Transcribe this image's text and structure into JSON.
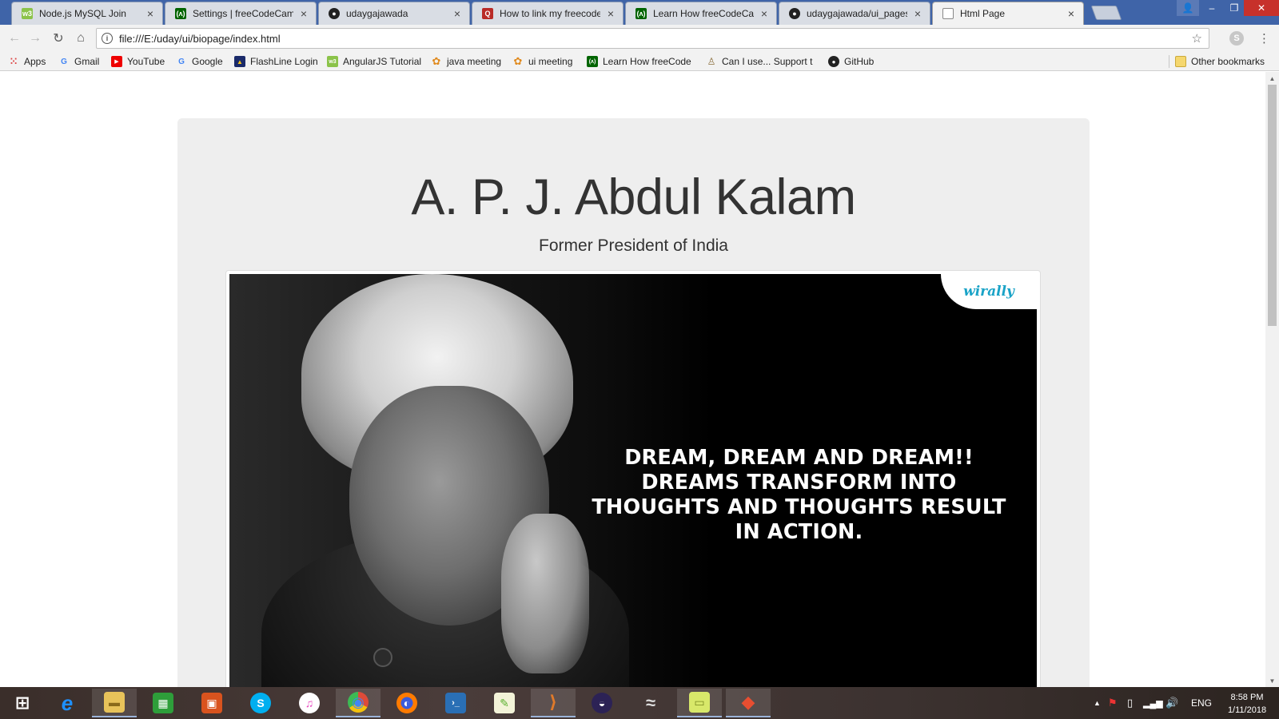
{
  "browser": {
    "tabs": [
      {
        "title": "Node.js MySQL Join",
        "icon": "w3schools-icon",
        "color": "#8bc34a",
        "active": false
      },
      {
        "title": "Settings | freeCodeCamp",
        "icon": "freecodecamp-icon",
        "color": "#006400",
        "active": false
      },
      {
        "title": "udaygajawada",
        "icon": "github-icon",
        "color": "#222222",
        "active": false
      },
      {
        "title": "How to link my freecode",
        "icon": "quora-icon",
        "color": "#b92b27",
        "active": false
      },
      {
        "title": "Learn How freeCodeCam",
        "icon": "freecodecamp-icon",
        "color": "#006400",
        "active": false
      },
      {
        "title": "udaygajawada/ui_pages",
        "icon": "github-icon",
        "color": "#222222",
        "active": false
      },
      {
        "title": "Html Page",
        "icon": "page-icon",
        "color": "#888888",
        "active": true
      }
    ],
    "close_glyph": "×",
    "window_controls": {
      "user": "👤",
      "minimize": "–",
      "maximize": "❐",
      "close": "✕"
    },
    "url": "file:///E:/uday/ui/biopage/index.html",
    "star_glyph": "☆",
    "skype_glyph": "S",
    "menu_glyph": "⋮",
    "bookmarks": [
      {
        "label": "Apps",
        "icon": "apps-grid-icon",
        "color": "#d44"
      },
      {
        "label": "Gmail",
        "icon": "google-icon",
        "color": "#4285f4"
      },
      {
        "label": "YouTube",
        "icon": "youtube-icon",
        "color": "#e00"
      },
      {
        "label": "Google",
        "icon": "google-icon",
        "color": "#4285f4"
      },
      {
        "label": "FlashLine Login",
        "icon": "flashline-icon",
        "color": "#1a2a6a"
      },
      {
        "label": "AngularJS Tutorial",
        "icon": "w3schools-icon",
        "color": "#8bc34a"
      },
      {
        "label": "java meeting",
        "icon": "meeting-icon",
        "color": "#e08a1e"
      },
      {
        "label": "ui meeting",
        "icon": "meeting-icon",
        "color": "#e08a1e"
      },
      {
        "label": "Learn How freeCode",
        "icon": "freecodecamp-icon",
        "color": "#006400"
      },
      {
        "label": "Can I use... Support t",
        "icon": "caniuse-icon",
        "color": "#8a6d3b"
      },
      {
        "label": "GitHub",
        "icon": "github-icon",
        "color": "#222222"
      }
    ],
    "other_bookmarks": "Other bookmarks"
  },
  "page": {
    "title": "A. P. J. Abdul Kalam",
    "subtitle": "Former President of India",
    "image": {
      "quote": "DREAM, DREAM AND DREAM!! DREAMS TRANSFORM INTO THOUGHTS AND THOUGHTS RESULT IN ACTION.",
      "brand": "wirally"
    }
  },
  "taskbar": {
    "apps": [
      {
        "name": "start-button",
        "glyph": "⊞",
        "color": "#ffffff"
      },
      {
        "name": "internet-explorer-icon",
        "glyph": "e",
        "color": "#1e90ff"
      },
      {
        "name": "file-explorer-icon",
        "glyph": "▬",
        "color": "#e8c35a"
      },
      {
        "name": "store-icon",
        "glyph": "▦",
        "color": "#2e9e3a"
      },
      {
        "name": "office-icon",
        "glyph": "▣",
        "color": "#d9531e"
      },
      {
        "name": "skype-icon",
        "glyph": "S",
        "color": "#00aff0"
      },
      {
        "name": "itunes-icon",
        "glyph": "♫",
        "color": "#ea4cc0"
      },
      {
        "name": "chrome-icon",
        "glyph": "◉",
        "color": "#dd4b39"
      },
      {
        "name": "firefox-icon",
        "glyph": "◐",
        "color": "#ff7b00"
      },
      {
        "name": "powershell-icon",
        "glyph": "›_",
        "color": "#2a6fb5"
      },
      {
        "name": "notepad-plus-icon",
        "glyph": "✎",
        "color": "#5bb030"
      },
      {
        "name": "visual-studio-code-icon",
        "glyph": "⟩",
        "color": "#e07a2a"
      },
      {
        "name": "eclipse-icon",
        "glyph": "◒",
        "color": "#2c2255"
      },
      {
        "name": "mysql-workbench-icon",
        "glyph": "≈",
        "color": "#555555"
      },
      {
        "name": "sticky-notes-icon",
        "glyph": "▭",
        "color": "#d8e86a"
      },
      {
        "name": "git-icon",
        "glyph": "◆",
        "color": "#e84e31"
      }
    ],
    "language": "ENG",
    "time": "8:58 PM",
    "date": "1/11/2018"
  }
}
